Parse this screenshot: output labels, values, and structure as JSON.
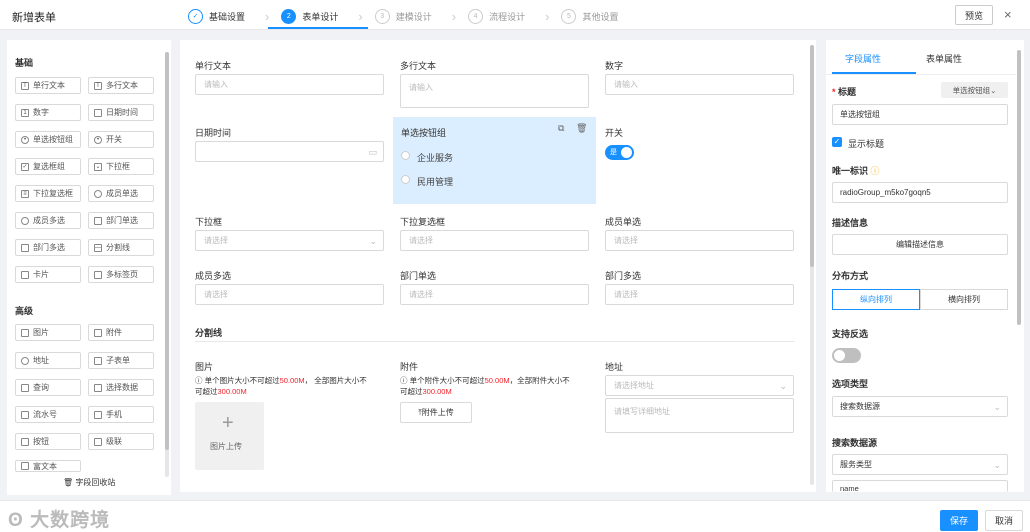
{
  "header": {
    "title": "新增表单",
    "steps": [
      {
        "num": "✓",
        "label": "基础设置"
      },
      {
        "num": "2",
        "label": "表单设计"
      },
      {
        "num": "3",
        "label": "建模设计"
      },
      {
        "num": "4",
        "label": "流程设计"
      },
      {
        "num": "5",
        "label": "其他设置"
      }
    ],
    "preview_label": "预览",
    "close_icon": "×"
  },
  "palette": {
    "basic_title": "基础",
    "advanced_title": "高级",
    "basic": [
      "单行文本",
      "多行文本",
      "数字",
      "日期时间",
      "单选按钮组",
      "开关",
      "复选框组",
      "下拉框",
      "下拉复选框",
      "成员单选",
      "成员多选",
      "部门单选",
      "部门多选",
      "分割线",
      "卡片",
      "多标签页"
    ],
    "advanced": [
      "图片",
      "附件",
      "地址",
      "子表单",
      "查询",
      "选择数据",
      "流水号",
      "手机",
      "按钮",
      "级联",
      "富文本"
    ],
    "recycle_label": "字段回收站"
  },
  "canvas": {
    "f1": {
      "label": "单行文本",
      "placeholder": "请输入"
    },
    "f2": {
      "label": "多行文本",
      "placeholder": "请输入"
    },
    "f3": {
      "label": "数字",
      "placeholder": "请输入"
    },
    "f4": {
      "label": "日期时间"
    },
    "f5": {
      "label": "单选按钮组",
      "options": [
        "企业服务",
        "民用管理"
      ]
    },
    "f6": {
      "label": "开关",
      "on_text": "是"
    },
    "f7": {
      "label": "下拉框",
      "placeholder": "请选择"
    },
    "f8": {
      "label": "下拉复选框",
      "placeholder": "请选择"
    },
    "f9": {
      "label": "成员单选",
      "placeholder": "请选择"
    },
    "f10": {
      "label": "成员多选",
      "placeholder": "请选择"
    },
    "f11": {
      "label": "部门单选",
      "placeholder": "请选择"
    },
    "f12": {
      "label": "部门多选",
      "placeholder": "请选择"
    },
    "divider_label": "分割线",
    "image": {
      "label": "图片",
      "note_a": "单个图片大小不可超过",
      "note_a_val": "50.00M",
      "note_b": "， 全部图片大小不",
      "note_c": "可超过",
      "note_c_val": "300.00M",
      "upload_label": "图片上传"
    },
    "attach": {
      "label": "附件",
      "note_a": "单个附件大小不可超过",
      "note_a_val": "50.00M",
      "note_b": "，全部附件大小不",
      "note_c": "可超过",
      "note_c_val": "300.00M",
      "upload_label": "附件上传"
    },
    "address": {
      "label": "地址",
      "select_placeholder": "请选择地址",
      "detail_placeholder": "请填写详细地址"
    }
  },
  "props": {
    "tab_field": "字段属性",
    "tab_form": "表单属性",
    "title_label": "标题",
    "title_type": "单选按钮组",
    "title_value": "单选按钮组",
    "show_title": "显示标题",
    "uid_label": "唯一标识",
    "uid_value": "radioGroup_m5ko7goqn5",
    "desc_label": "描述信息",
    "desc_button": "编辑描述信息",
    "layout_label": "分布方式",
    "layout_vertical": "纵向排列",
    "layout_horizontal": "横向排列",
    "invert_label": "支持反选",
    "option_type_label": "选项类型",
    "option_type_value": "搜索数据源",
    "source_label": "搜索数据源",
    "source_value": "服务类型",
    "name_value": "name"
  },
  "footer": {
    "save": "保存",
    "cancel": "取消",
    "watermark": "大数跨境"
  },
  "colors": {
    "primary": "#1890ff",
    "selected_bg": "#dbeeff",
    "danger": "#f5222d"
  }
}
